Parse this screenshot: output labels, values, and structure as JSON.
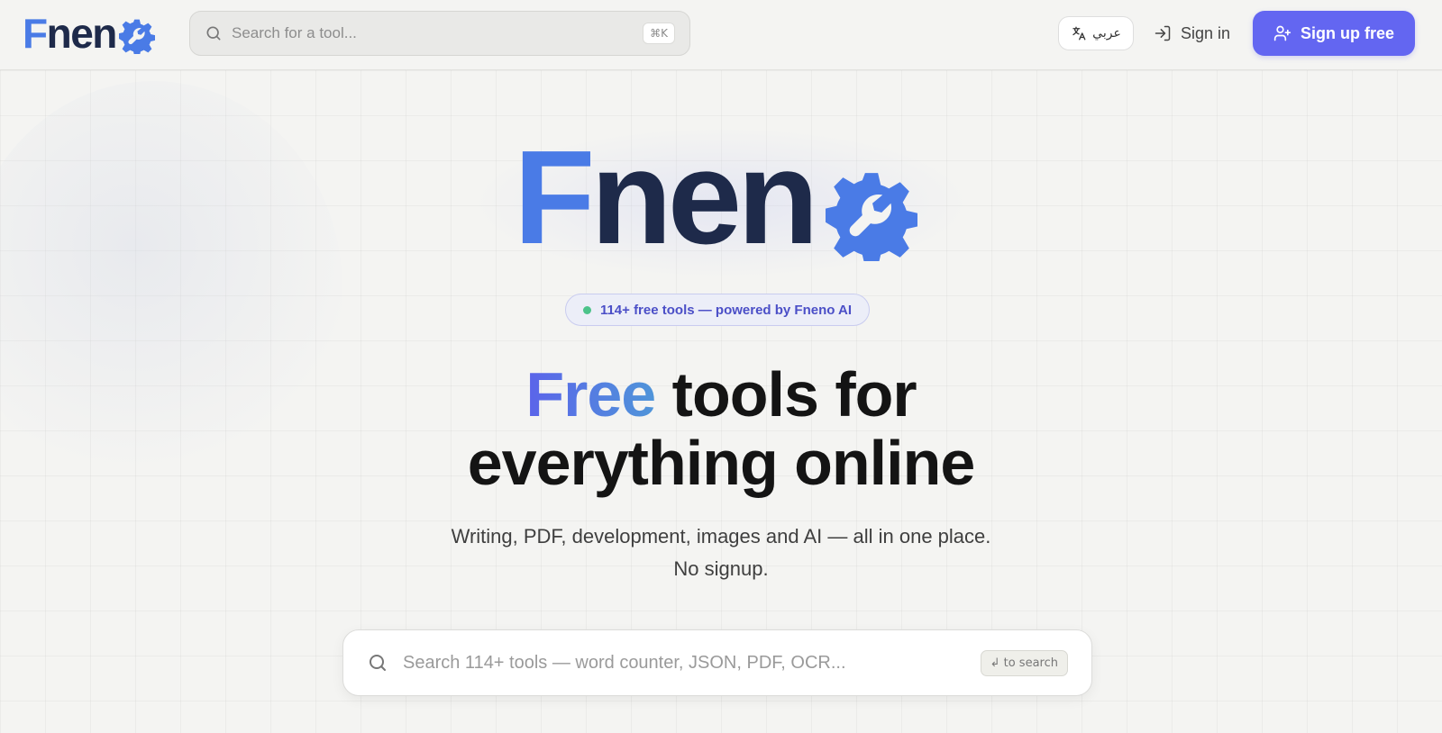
{
  "brand": {
    "logo_first": "F",
    "logo_rest": "nen",
    "logo_mark_icon": "gear-wrench-icon",
    "colors": {
      "primary": "#6366f1",
      "logo_blue": "#4a7be6",
      "logo_navy": "#1e2a4a"
    }
  },
  "header": {
    "search_placeholder": "Search for a tool...",
    "search_shortcut": "⌘K",
    "language_label": "عربي",
    "signin_label": "Sign in",
    "signup_label": "Sign up free"
  },
  "hero": {
    "badge_text": "114+ free tools — powered by Fneno AI",
    "headline_highlight": "Free",
    "headline_rest_line1": " tools for",
    "headline_line2": "everything online",
    "subtext_line1": "Writing, PDF, development, images and AI — all in one place.",
    "subtext_line2": "No signup.",
    "search_placeholder": "Search 114+ tools — word counter, JSON, PDF, OCR...",
    "search_hint": "↲ to search"
  }
}
